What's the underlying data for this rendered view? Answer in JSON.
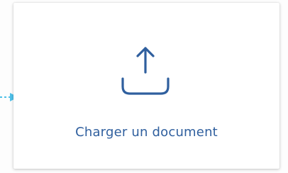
{
  "upload_card": {
    "label": "Charger un document",
    "icon": "upload-icon",
    "icon_color": "#2f5f9e",
    "text_color": "#2f5f9e"
  },
  "connector": {
    "icon": "arrow-right-icon",
    "color": "#4fc0e8"
  }
}
